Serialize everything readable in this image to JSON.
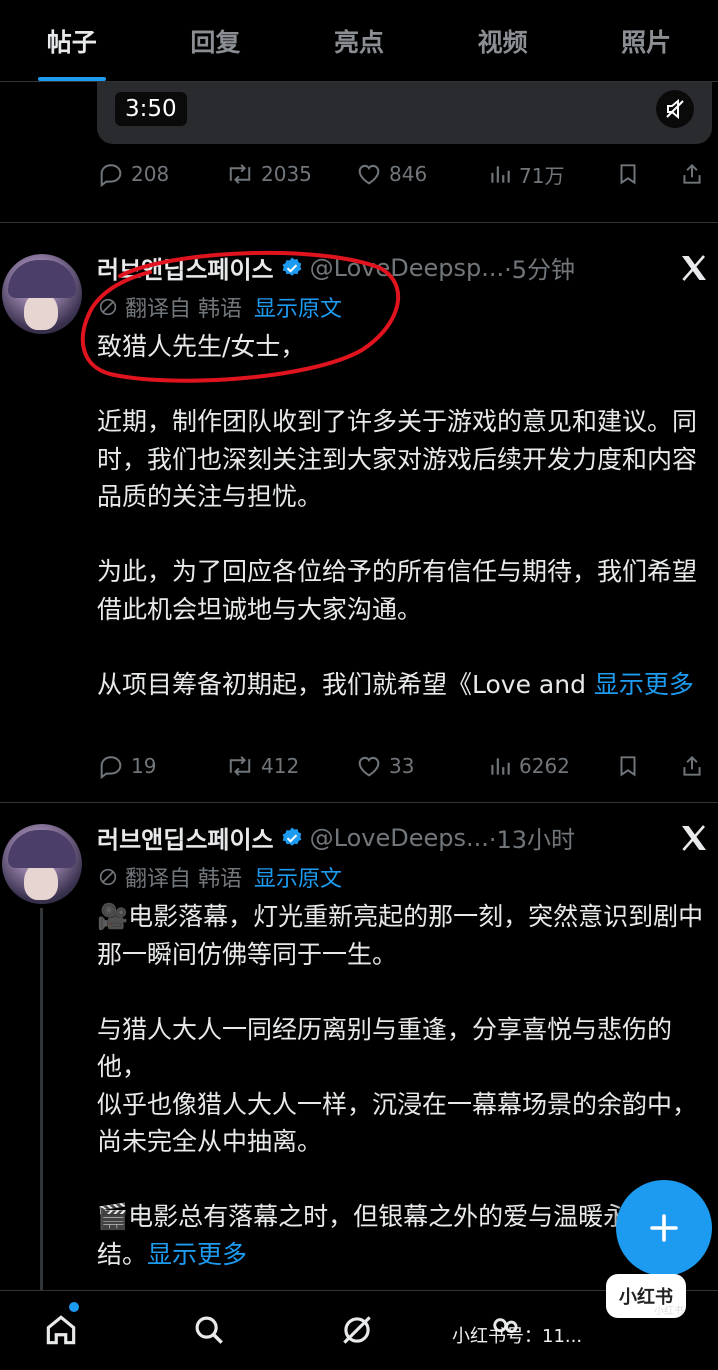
{
  "tabs": [
    {
      "label": "帖子",
      "active": true
    },
    {
      "label": "回复"
    },
    {
      "label": "亮点"
    },
    {
      "label": "视频"
    },
    {
      "label": "照片"
    }
  ],
  "video": {
    "time": "3:50"
  },
  "post0": {
    "replies": "208",
    "reposts": "2035",
    "likes": "846",
    "views": "71万"
  },
  "post1": {
    "name": "러브앤딥스페이스",
    "handle": "@LoveDeepsp...",
    "time": "·5分钟",
    "translated_from": "翻译自 韩语",
    "show_original": "显示原文",
    "paragraphs": [
      "致猎人先生/女士，",
      "近期，制作团队收到了许多关于游戏的意见和建议。同时，我们也深刻关注到大家对游戏后续开发力度和内容品质的关注与担忧。",
      "为此，为了回应各位给予的所有信任与期待，我们希望借此机会坦诚地与大家沟通。"
    ],
    "last_line": "从项目筹备初期起，我们就希望《Love and ",
    "show_more": "显示更多",
    "replies": "19",
    "reposts": "412",
    "likes": "33",
    "views": "6262"
  },
  "post2": {
    "name": "러브앤딥스페이스",
    "handle": "@LoveDeeps...",
    "time": "·13小时",
    "translated_from": "翻译自 韩语",
    "show_original": "显示原文",
    "paragraphs": [
      "🎥电影落幕，灯光重新亮起的那一刻，突然意识到剧中那一瞬间仿佛等同于一生。",
      "与猎人大人一同经历离别与重逢，分享喜悦与悲伤的他，\n似乎也像猎人大人一样，沉浸在一幕幕场景的余韵中，尚未完全从中抽离。"
    ],
    "last_line": "🎬电影总有落幕之时，但银幕之外的爱与温暖永不终结。",
    "show_more": "显示更多"
  },
  "watermark": {
    "badge": "小红书",
    "text": "小红书号：11...",
    "small": "小红书"
  },
  "colors": {
    "accent": "#1d9bf0",
    "background": "#000000",
    "muted": "#71767b",
    "annotation": "#e0141e"
  }
}
